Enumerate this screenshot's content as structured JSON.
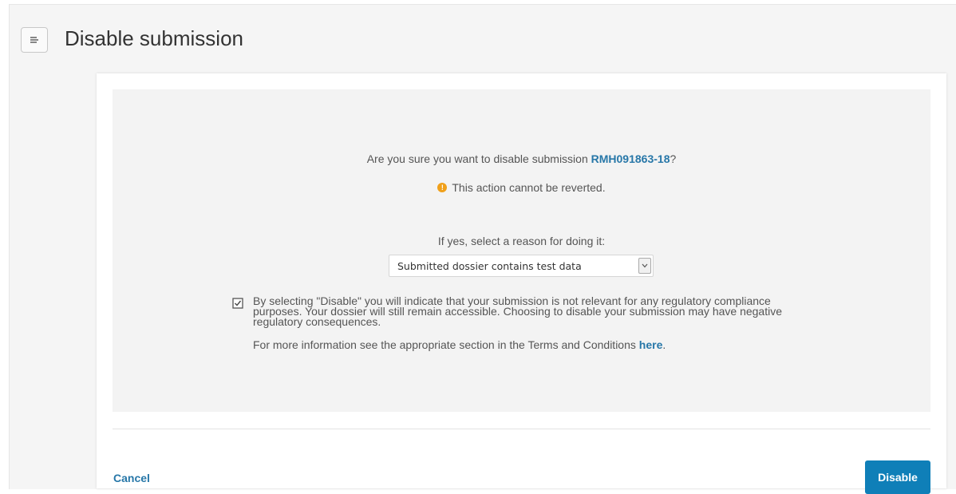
{
  "header": {
    "title": "Disable submission",
    "menu_icon": "hamburger-menu-icon"
  },
  "dialog": {
    "question_prefix": "Are you sure you want to disable submission ",
    "submission_id": "RMH091863-18",
    "question_suffix": "?",
    "warning_icon": "warning-circle-icon",
    "warning_icon_glyph": "!",
    "warning_text": "This action cannot be reverted.",
    "reason_label": "If yes, select a reason for doing it:",
    "reason_select": {
      "selected": "Submitted dossier contains test data"
    },
    "consent": {
      "checked": true,
      "text": "By selecting \"Disable\" you will indicate that your submission is not relevant for any regulatory compliance purposes. Your dossier will still remain accessible. Choosing to disable your submission may have negative regulatory consequences."
    },
    "more_info_prefix": "For more information see the appropriate section in the Terms and Conditions ",
    "more_info_link": "here",
    "more_info_suffix": "."
  },
  "footer": {
    "cancel_label": "Cancel",
    "disable_label": "Disable"
  },
  "colors": {
    "accent": "#0f7fb8",
    "link": "#2777a8",
    "warning": "#f0a01a",
    "panel_background": "#f3f3f3"
  }
}
